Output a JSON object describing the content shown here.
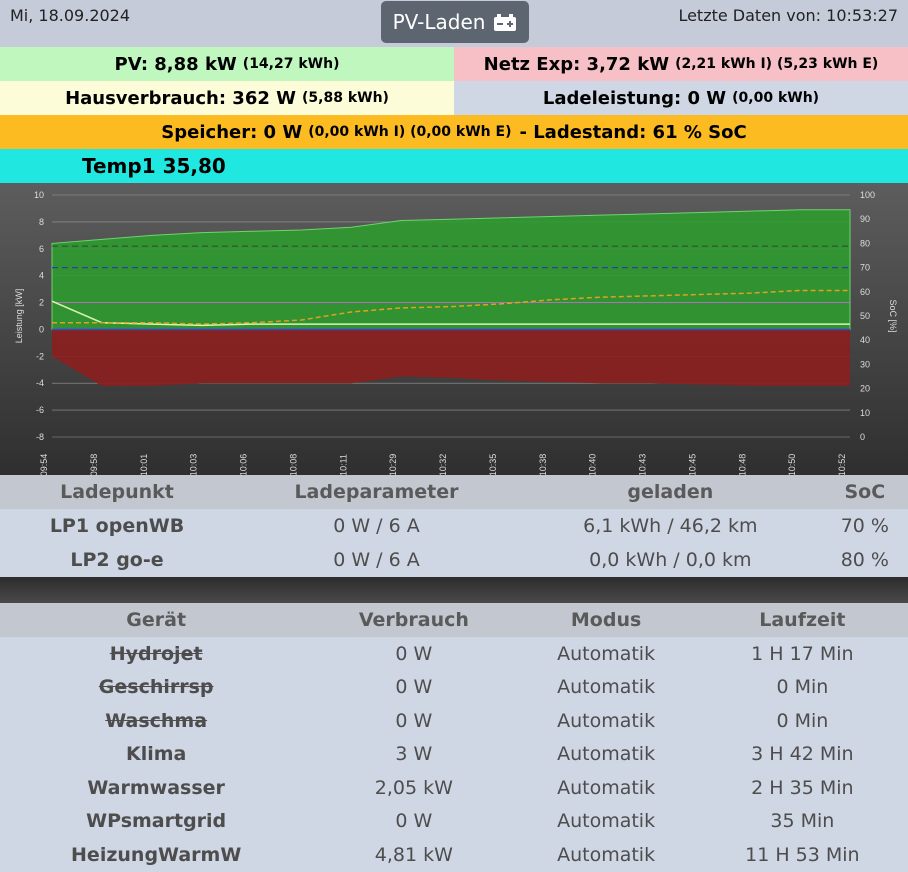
{
  "header": {
    "date": "Mi, 18.09.2024",
    "title": "PV-Laden",
    "last_data": "Letzte Daten von: 10:53:27"
  },
  "status": {
    "pv_main": "PV: 8,88 kW",
    "pv_sub": "(14,27 kWh)",
    "grid_main": "Netz Exp: 3,72 kW",
    "grid_sub": "(2,21 kWh I) (5,23 kWh E)",
    "house_main": "Hausverbrauch: 362 W",
    "house_sub": "(5,88 kWh)",
    "charge_main": "Ladeleistung: 0 W",
    "charge_sub": "(0,00 kWh)",
    "storage_main": "Speicher: 0 W",
    "storage_sub": "(0,00 kWh I) (0,00 kWh E)",
    "storage_soc": "- Ladestand: 61 % SoC",
    "temp": "Temp1 35,80"
  },
  "colors": {
    "pv": "#bff7bf",
    "grid": "#f7c0c6",
    "house": "#fcfcd9",
    "charge": "#cfd6e4",
    "storage": "#fcbb20",
    "temp": "#20e8e0"
  },
  "chart_data": {
    "type": "area",
    "x": [
      "09:54",
      "09:58",
      "10:01",
      "10:03",
      "10:06",
      "10:08",
      "10:11",
      "10:29",
      "10:32",
      "10:35",
      "10:38",
      "10:40",
      "10:43",
      "10:45",
      "10:48",
      "10:50",
      "10:52"
    ],
    "ylabel": "Leistung [kW]",
    "ylabel_right": "SoC [%]",
    "ylim": [
      -8,
      10
    ],
    "ylim_right": [
      0,
      100
    ],
    "yticks": [
      -8,
      -6,
      -4,
      -2,
      0,
      2,
      4,
      6,
      8,
      10
    ],
    "yticks_right": [
      0,
      10,
      20,
      30,
      40,
      50,
      60,
      70,
      80,
      90,
      100
    ],
    "series": [
      {
        "values": [
          6.4,
          6.7,
          7.0,
          7.2,
          7.3,
          7.4,
          7.6,
          8.1,
          8.2,
          8.3,
          8.4,
          8.5,
          8.6,
          8.7,
          8.8,
          8.9,
          8.9
        ]
      },
      {
        "values": [
          -2.0,
          -4.2,
          -4.2,
          -4.0,
          -4.0,
          -4.0,
          -4.0,
          -3.5,
          -3.6,
          -3.8,
          -3.9,
          -4.0,
          -4.0,
          -4.1,
          -4.2,
          -4.2,
          -4.2
        ]
      },
      {
        "values": [
          2.1,
          0.5,
          0.4,
          0.3,
          0.4,
          0.4,
          0.4,
          0.4,
          0.4,
          0.4,
          0.4,
          0.4,
          0.4,
          0.4,
          0.4,
          0.4,
          0.4
        ]
      },
      {
        "values": [
          0.5,
          0.5,
          0.5,
          0.4,
          0.5,
          0.7,
          1.3,
          1.6,
          1.7,
          1.9,
          2.2,
          2.4,
          2.5,
          2.6,
          2.7,
          2.9,
          2.9
        ]
      }
    ]
  },
  "chargepoints": {
    "headers": [
      "Ladepunkt",
      "Ladeparameter",
      "geladen",
      "SoC"
    ],
    "rows": [
      {
        "name": "LP1 openWB",
        "param": "0 W / 6 A",
        "charged": "6,1 kWh / 46,2 km",
        "soc": "70 %"
      },
      {
        "name": "LP2 go-e",
        "param": "0 W / 6 A",
        "charged": "0,0 kWh / 0,0 km",
        "soc": "80 %"
      }
    ]
  },
  "devices": {
    "headers": [
      "Gerät",
      "Verbrauch",
      "Modus",
      "Laufzeit"
    ],
    "rows": [
      {
        "name": "Hydrojet",
        "usage": "0 W",
        "mode": "Automatik",
        "runtime": "1 H 17 Min",
        "state": "off"
      },
      {
        "name": "Geschirrsp",
        "usage": "0 W",
        "mode": "Automatik",
        "runtime": "0 Min",
        "state": "off"
      },
      {
        "name": "Waschma",
        "usage": "0 W",
        "mode": "Automatik",
        "runtime": "0 Min",
        "state": "off"
      },
      {
        "name": "Klima",
        "usage": "3 W",
        "mode": "Automatik",
        "runtime": "3 H 42 Min",
        "state": "on"
      },
      {
        "name": "Warmwasser",
        "usage": "2,05 kW",
        "mode": "Automatik",
        "runtime": "2 H 35 Min",
        "state": "on"
      },
      {
        "name": "WPsmartgrid",
        "usage": "0 W",
        "mode": "Automatik",
        "runtime": "35 Min",
        "state": "on"
      },
      {
        "name": "HeizungWarmW",
        "usage": "4,81 kW",
        "mode": "Automatik",
        "runtime": "11 H 53 Min",
        "state": "on"
      }
    ]
  }
}
